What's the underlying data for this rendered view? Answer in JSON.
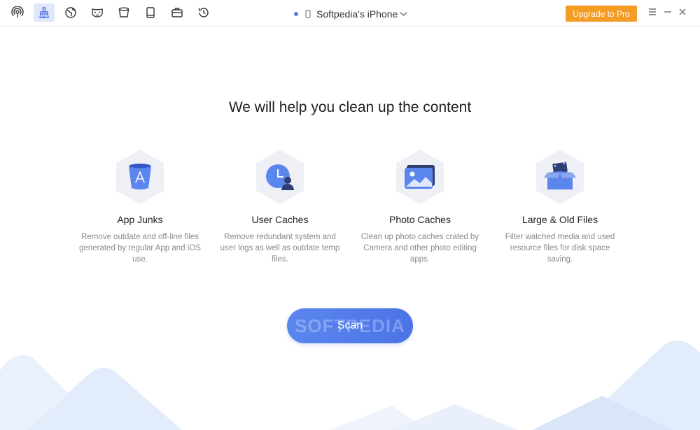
{
  "toolbar": {
    "tools": [
      {
        "icon": "airdrop-icon",
        "active": false
      },
      {
        "icon": "broom-icon",
        "active": true
      },
      {
        "icon": "globe-icon",
        "active": false
      },
      {
        "icon": "mask-icon",
        "active": false
      },
      {
        "icon": "bucket-icon",
        "active": false
      },
      {
        "icon": "book-icon",
        "active": false
      },
      {
        "icon": "briefcase-icon",
        "active": false
      },
      {
        "icon": "history-icon",
        "active": false
      }
    ]
  },
  "device": {
    "name": "Softpedia's iPhone",
    "status_color": "#4f7ff0"
  },
  "upgrade": {
    "label": "Upgrade to Pro",
    "color": "#f39c26"
  },
  "window": {
    "menu_icon": "menu-icon",
    "minimize_icon": "minimize-icon",
    "close_icon": "close-icon"
  },
  "main": {
    "headline": "We will help you clean up the content",
    "features": [
      {
        "icon": "app-store-bucket-icon",
        "title": "App Junks",
        "desc": "Remove outdate and off-line files generated by regular App and iOS use."
      },
      {
        "icon": "clock-user-icon",
        "title": "User Caches",
        "desc": "Remove redundant system and user logs as well as outdate temp files."
      },
      {
        "icon": "photo-icon",
        "title": "Photo Caches",
        "desc": "Clean up photo caches crated by Camera and other photo editing apps."
      },
      {
        "icon": "open-box-icon",
        "title": "Large & Old Files",
        "desc": "Filter watched media and used resource files for disk space saving."
      }
    ],
    "scan_label": "Scan",
    "watermark": "SOFTPEDIA"
  },
  "colors": {
    "accent": "#4b73e6",
    "hex_bg": "#eef0f6",
    "mountain": "#e6eefb"
  }
}
